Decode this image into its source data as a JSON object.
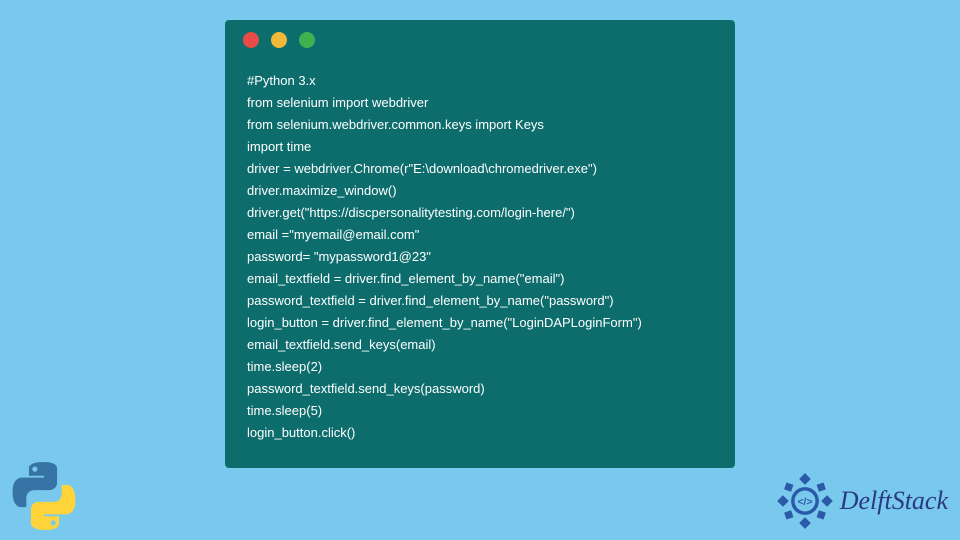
{
  "code_window": {
    "lines": [
      "#Python 3.x",
      "from selenium import webdriver",
      "from selenium.webdriver.common.keys import Keys",
      "import time",
      "driver = webdriver.Chrome(r\"E:\\download\\chromedriver.exe\")",
      "driver.maximize_window()",
      "driver.get(\"https://discpersonalitytesting.com/login-here/\")",
      "email =\"myemail@email.com\"",
      "password= \"mypassword1@23\"",
      "email_textfield = driver.find_element_by_name(\"email\")",
      "password_textfield = driver.find_element_by_name(\"password\")",
      "login_button = driver.find_element_by_name(\"LoginDAPLoginForm\")",
      "email_textfield.send_keys(email)",
      "time.sleep(2)",
      "password_textfield.send_keys(password)",
      "time.sleep(5)",
      "login_button.click()"
    ]
  },
  "branding": {
    "site_name": "DelftStack"
  },
  "colors": {
    "background": "#78c9ed",
    "window": "#0d6d6d",
    "dot_red": "#e94b47",
    "dot_yellow": "#f0b93a",
    "dot_green": "#3fb24f",
    "brand_text": "#2a3a82"
  }
}
